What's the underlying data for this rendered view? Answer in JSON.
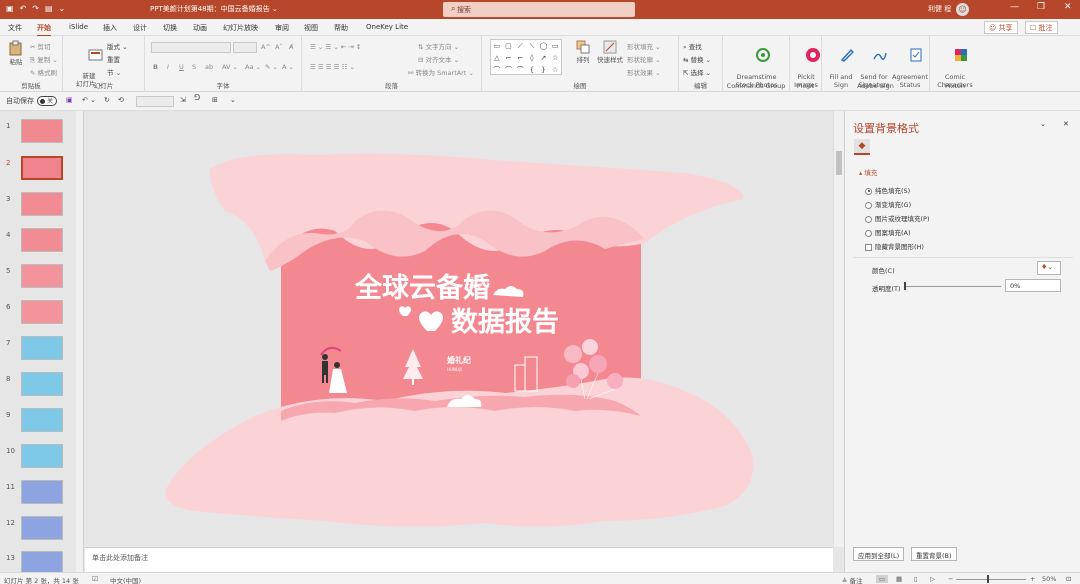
{
  "titlebar": {
    "doc_title": "PPT美颜计划第48期：中国云备婚报告 ⌄",
    "search_placeholder": "搜索",
    "user_name": "利健 程",
    "avatar_letter": "☺",
    "minimize": "—",
    "restore": "❐",
    "close": "✕",
    "qa_save": "▣",
    "qa_undo": "↶",
    "qa_redo": "↷",
    "qa_start": "▤",
    "qa_more": "⌄"
  },
  "menu": {
    "tabs": [
      "文件",
      "开始",
      "iSlide",
      "插入",
      "设计",
      "切换",
      "动画",
      "幻灯片放映",
      "审阅",
      "视图",
      "帮助",
      "OneKey Lite"
    ],
    "active_tab": "开始",
    "share": "☺ 共享",
    "comment": "☐ 批注"
  },
  "ribbon": {
    "clipboard": {
      "label": "剪贴板",
      "paste": "粘贴",
      "cut": "✂ 剪切",
      "copy": "⎘ 复制 ⌄",
      "format_painter": "✎ 格式刷"
    },
    "slides": {
      "label": "幻灯片",
      "new_slide": "新建\n幻灯片 ⌄",
      "layout": "版式 ⌄",
      "reset": "重置",
      "section": "节 ⌄"
    },
    "font": {
      "label": "字体",
      "grow": "A^",
      "shrink": "Aˇ",
      "clear": "A̸",
      "bold": "B",
      "italic": "I",
      "underline": "U",
      "strike": "S",
      "shadow": "ab",
      "spacing": "AV ⌄",
      "case": "Aa ⌄",
      "highlight": "✎ ⌄",
      "color": "A ⌄"
    },
    "paragraph": {
      "label": "段落",
      "text_dir": "⇅ 文字方向 ⌄",
      "align_text": "⊟ 对齐文本 ⌄",
      "smartart": "⚯ 转换为 SmartArt ⌄"
    },
    "drawing": {
      "label": "绘图",
      "arrange": "排列",
      "quick_styles": "快速样式",
      "fill": "形状填充 ⌄",
      "outline": "形状轮廓 ⌄",
      "effects": "形状效果 ⌄",
      "shapes": [
        "▭",
        "▢",
        "⟋",
        "⟍",
        "◯",
        "▭",
        "△",
        "⌐",
        "⌐",
        "◊",
        "↗",
        "☆",
        "⌒",
        "⌒",
        "⌒",
        "{",
        "}",
        "☆"
      ]
    },
    "editing": {
      "label": "编辑",
      "find": "⌕ 查找",
      "replace": "⇆ 替换 ⌄",
      "select": "⇱ 选择 ⌄"
    },
    "dreamstime": {
      "label": "Commands Group",
      "name": "Dreamstime\nStock Photos"
    },
    "pickit": {
      "label": "Pickit",
      "name": "Pickit\nImages"
    },
    "adobe": {
      "label": "Adobe Sign",
      "fill_sign": "Fill and\nSign",
      "send": "Send for\nSignature",
      "status": "Agreement\nStatus"
    },
    "pixton": {
      "label": "Pixton",
      "comic": "Comic\nCharacters"
    }
  },
  "qat": {
    "autosave": "自动保存",
    "autosave_state": "关",
    "save_icon": "▣",
    "undo": "↶ ⌄",
    "redo": "↻",
    "repeat": "⟲",
    "size_icon": "⇲",
    "more": "⌄"
  },
  "thumbnails": {
    "numbers": [
      "1",
      "2",
      "3",
      "4",
      "5",
      "6",
      "7",
      "8",
      "9",
      "10",
      "11",
      "12",
      "13"
    ],
    "selected": "2",
    "colors": [
      "#f08a91",
      "#f0838c",
      "#f28c94",
      "#f28c94",
      "#f3939b",
      "#f3939b",
      "#7ec8e8",
      "#7ec8e8",
      "#7ec8e8",
      "#7ec8e8",
      "#8ea4e0",
      "#8ea4e0",
      "#8ea4e0"
    ]
  },
  "slide": {
    "title_line1": "全球云备婚",
    "title_line2": "数据报告",
    "year_top": "2020",
    "year": "2020",
    "brand": "婚礼纪",
    "brand_sub": "HUNLIJI",
    "colors": {
      "bg": "#f48890",
      "pink_light": "#fbd3d6",
      "pink_mid": "#f9c2c7",
      "pink_deep": "#f7a7ae"
    }
  },
  "notes": {
    "placeholder": "单击此处添加备注"
  },
  "format_pane": {
    "title": "设置背景格式",
    "close": "✕",
    "dropdown": "⌄",
    "icon": "◆",
    "section": "▴ 填充",
    "options": [
      {
        "label": "纯色填充(S)",
        "checked": true
      },
      {
        "label": "渐变填充(G)",
        "checked": false
      },
      {
        "label": "图片或纹理填充(P)",
        "checked": false
      },
      {
        "label": "图案填充(A)",
        "checked": false
      }
    ],
    "hide_bg": "隐藏背景图形(H)",
    "color_label": "颜色(C)",
    "transparency_label": "透明度(T)",
    "transparency_value": "0%",
    "apply_all": "应用到全部(L)",
    "reset_bg": "重置背景(B)"
  },
  "statusbar": {
    "slide_info": "幻灯片 第 2 张，共 14 张",
    "lang": "中文(中国)",
    "notes": "≜ 备注",
    "zoom": "50%",
    "fit": "⊡",
    "accessibility_icon": "☑"
  }
}
